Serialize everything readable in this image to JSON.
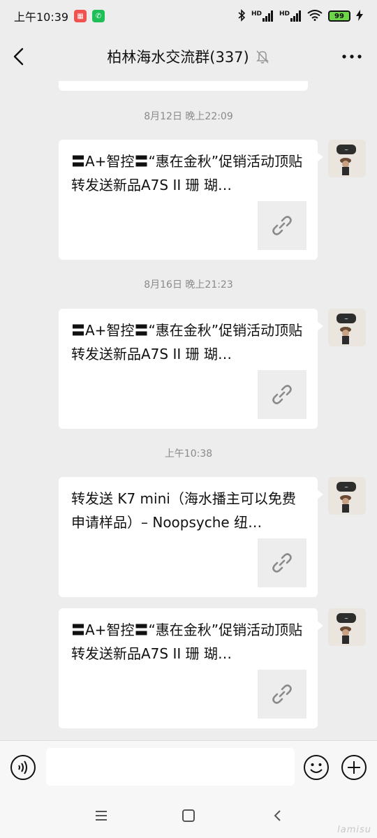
{
  "status_bar": {
    "time": "上午10:39",
    "network_1": "HD",
    "network_2": "HD",
    "battery": "99"
  },
  "header": {
    "title": "柏林海水交流群(337)"
  },
  "messages": [
    {
      "timestamp": "8月12日 晚上22:09",
      "title": "〓A+智控〓“惠在金秋”促销活动顶贴转发送新品A7S II 珊 瑚…"
    },
    {
      "timestamp": "8月16日 晚上21:23",
      "title": "〓A+智控〓“惠在金秋”促销活动顶贴转发送新品A7S II 珊 瑚…"
    },
    {
      "timestamp": "上午10:38",
      "title": "转发送 K7 mini（海水播主可以免费申请样品）– Noopsyche 纽…"
    },
    {
      "timestamp": "",
      "title": "〓A+智控〓“惠在金秋”促销活动顶贴转发送新品A7S II 珊 瑚…"
    }
  ],
  "input": {
    "value": "",
    "placeholder": ""
  },
  "colors": {
    "background": "#ededed",
    "bubble": "#ffffff",
    "timestamp": "#8a8a8a"
  },
  "icons": [
    "back-icon",
    "mute-bell-icon",
    "more-icon",
    "link-icon",
    "voice-icon",
    "emoji-icon",
    "plus-icon",
    "menu-icon",
    "home-icon",
    "nav-back-icon"
  ]
}
